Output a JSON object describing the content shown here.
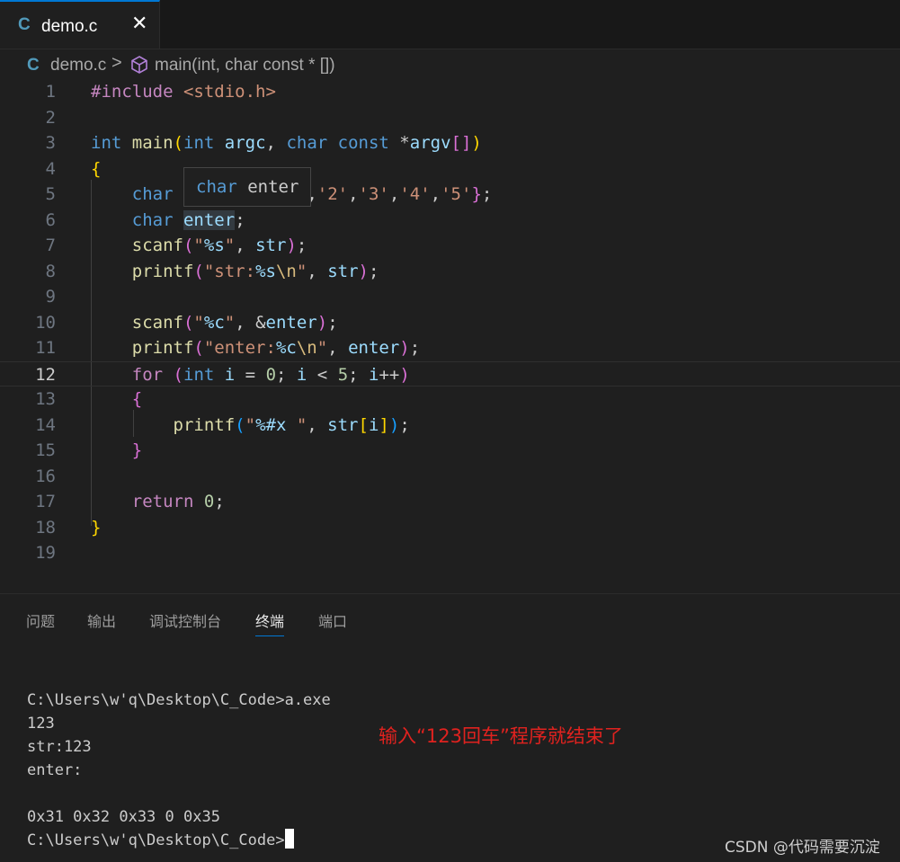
{
  "tab": {
    "icon": "C",
    "label": "demo.c",
    "close": "✕"
  },
  "breadcrumb": {
    "icon": "C",
    "file": "demo.c",
    "separator": ">",
    "symbol_icon": "cube-icon",
    "function": "main(int, char const * [])"
  },
  "editor": {
    "line_numbers": [
      "1",
      "2",
      "3",
      "4",
      "5",
      "6",
      "7",
      "8",
      "9",
      "10",
      "11",
      "12",
      "13",
      "14",
      "15",
      "16",
      "17",
      "18",
      "19"
    ],
    "active_line": "12",
    "tooltip": {
      "keyword": "char",
      "name": "enter"
    }
  },
  "panel": {
    "tabs": [
      "问题",
      "输出",
      "调试控制台",
      "终端",
      "端口"
    ],
    "active_tab": "终端"
  },
  "terminal": {
    "lines": [
      "C:\\Users\\w'q\\Desktop\\C_Code>a.exe",
      "123",
      "str:123",
      "enter:",
      "",
      "0x31 0x32 0x33 0 0x35",
      "C:\\Users\\w'q\\Desktop\\C_Code>"
    ]
  },
  "annotation": "输入“123回车”程序就结束了",
  "watermark": "CSDN @代码需要沉淀",
  "colors": {
    "accent": "#0078d4",
    "annotation": "#e0221f"
  }
}
